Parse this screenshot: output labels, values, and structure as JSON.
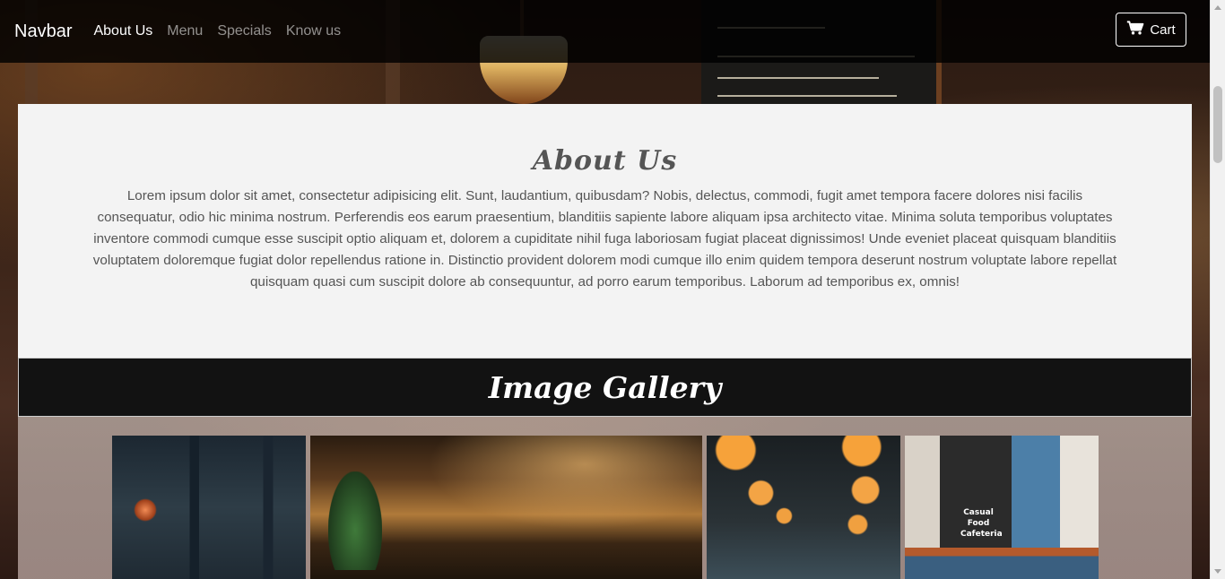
{
  "navbar": {
    "brand": "Navbar",
    "links": [
      {
        "label": "About Us",
        "active": true
      },
      {
        "label": "Menu",
        "active": false
      },
      {
        "label": "Specials",
        "active": false
      },
      {
        "label": "Know us",
        "active": false
      }
    ],
    "cart_label": "Cart",
    "cart_icon": "shopping-cart-icon"
  },
  "about": {
    "title": "About Us",
    "text": "Lorem ipsum dolor sit amet, consectetur adipisicing elit. Sunt, laudantium, quibusdam? Nobis, delectus, commodi, fugit amet tempora facere dolores nisi facilis consequatur, odio hic minima nostrum. Perferendis eos earum praesentium, blanditiis sapiente labore aliquam ipsa architecto vitae. Minima soluta temporibus voluptates inventore commodi cumque esse suscipit optio aliquam et, dolorem a cupiditate nihil fuga laboriosam fugiat placeat dignissimos! Unde eveniet placeat quisquam blanditiis voluptatem doloremque fugiat dolor repellendus ratione in. Distinctio provident dolorem modi cumque illo enim quidem tempora deserunt nostrum voluptate labore repellat quisquam quasi cum suscipit dolore ab consequuntur, ad porro earum temporibus. Laborum ad temporibus ex, omnis!"
  },
  "gallery": {
    "title": "Image Gallery",
    "images": [
      {
        "name": "gallery-image-window"
      },
      {
        "name": "gallery-image-bar-interior"
      },
      {
        "name": "gallery-image-pendant-lamps"
      },
      {
        "name": "gallery-image-cafeteria",
        "sign_text": "Casual Food Cafeteria"
      }
    ]
  },
  "colors": {
    "navbar_bg": "#000000",
    "about_bg": "#f3f3f3",
    "gallery_header_bg": "#121212",
    "text": "#555555"
  }
}
